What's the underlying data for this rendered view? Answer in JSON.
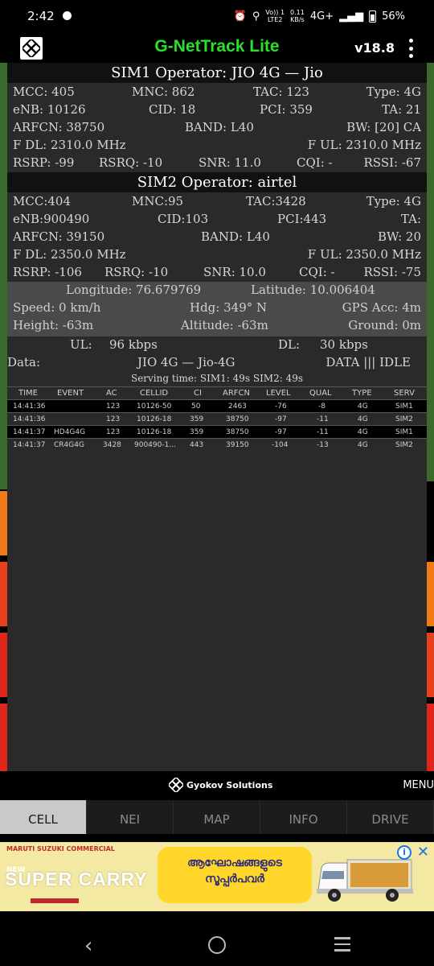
{
  "status": {
    "time": "2:42",
    "volte_line1": "Vo)) 1",
    "volte_line2": "LTE2",
    "speed_line1": "0.11",
    "speed_line2": "KB/s",
    "network": "4G+",
    "battery": "56%"
  },
  "app": {
    "title": "G-NetTrack Lite",
    "version": "v18.8"
  },
  "sim1": {
    "operator_header": "SIM1 Operator: JIO 4G — Jio",
    "mcc": "MCC: 405",
    "mnc": "MNC: 862",
    "tac": "TAC: 123",
    "type": "Type: 4G",
    "enb": "eNB: 10126",
    "cid": "CID: 18",
    "pci": "PCI: 359",
    "ta": "TA: 21",
    "arfcn": "ARFCN: 38750",
    "band": "BAND: L40",
    "bw": "BW: [20] CA",
    "fdl": "F DL: 2310.0 MHz",
    "ful": "F UL: 2310.0 MHz",
    "rsrp": "RSRP: -99",
    "rsrq": "RSRQ: -10",
    "snr": "SNR: 11.0",
    "cqi": "CQI: -",
    "rssi": "RSSI: -67"
  },
  "sim2": {
    "operator_header": "SIM2 Operator: airtel",
    "mcc": "MCC:404",
    "mnc": "MNC:95",
    "tac": "TAC:3428",
    "type": "Type: 4G",
    "enb": "eNB:900490",
    "cid": "CID:103",
    "pci": "PCI:443",
    "ta": "TA:",
    "arfcn": "ARFCN: 39150",
    "band": "BAND: L40",
    "bw": "BW: 20",
    "fdl": "F DL: 2350.0 MHz",
    "ful": "F UL: 2350.0 MHz",
    "rsrp": "RSRP: -106",
    "rsrq": "RSRQ: -10",
    "snr": "SNR: 10.0",
    "cqi": "CQI: -",
    "rssi": "RSSI: -75"
  },
  "gps": {
    "longitude": "Longitude: 76.679769",
    "latitude": "Latitude: 10.006404",
    "speed": "Speed: 0 km/h",
    "hdg": "Hdg: 349° N",
    "acc": "GPS Acc: 4m",
    "height": "Height: -63m",
    "altitude": "Altitude: -63m",
    "ground": "Ground: 0m"
  },
  "data": {
    "ul_label": "UL:",
    "ul_value": "96 kbps",
    "dl_label": "DL:",
    "dl_value": "30 kbps",
    "label": "Data:",
    "network": "JIO 4G — Jio-4G",
    "state": "DATA ||| IDLE",
    "serving": "Serving time: SIM1: 49s  SIM2: 49s"
  },
  "table": {
    "headers": [
      "TIME",
      "EVENT",
      "AC",
      "CELLID",
      "CI",
      "ARFCN",
      "LEVEL",
      "QUAL",
      "TYPE",
      "SERV"
    ],
    "rows": [
      [
        "14:41:36",
        "",
        "123",
        "10126-50",
        "50",
        "2463",
        "-76",
        "-8",
        "4G",
        "SIM1"
      ],
      [
        "14:41:36",
        "",
        "123",
        "10126-18",
        "359",
        "38750",
        "-97",
        "-11",
        "4G",
        "SIM2"
      ],
      [
        "14:41:37",
        "HD4G4G",
        "123",
        "10126-18",
        "359",
        "38750",
        "-97",
        "-11",
        "4G",
        "SIM1"
      ],
      [
        "14:41:37",
        "CR4G4G",
        "3428",
        "900490-1...",
        "443",
        "39150",
        "-104",
        "-13",
        "4G",
        "SIM2"
      ]
    ]
  },
  "footer": {
    "brand": "Gyokov Solutions",
    "menu": "MENU"
  },
  "tabs": [
    "CELL",
    "NEI",
    "MAP",
    "INFO",
    "DRIVE"
  ],
  "ad": {
    "brand": "MARUTI SUZUKI COMMERCIAL",
    "new": "NEW",
    "product": "SUPER CARRY",
    "malayalam_line1": "ആഘോഷങ്ങളുടെ",
    "malayalam_line2": "സൂപ്പർപവർ"
  },
  "colors": {
    "title_green": "#29e02a",
    "panel_bg": "#2a2a2a",
    "side_green": "#3a6b2c",
    "side_orange": "#f07a18",
    "side_red": "#e0251a"
  },
  "icons": [
    "whatsapp-icon",
    "alarm-icon",
    "location-icon",
    "signal-icon",
    "battery-icon",
    "app-logo-icon",
    "overflow-menu-icon",
    "info-icon",
    "close-icon",
    "back-icon",
    "home-icon",
    "recents-icon"
  ]
}
